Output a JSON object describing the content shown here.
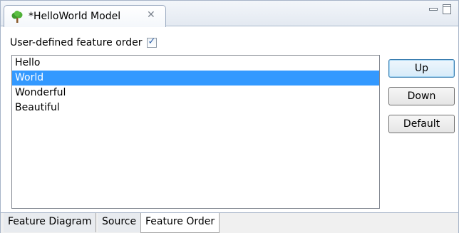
{
  "editor_tab": {
    "title": "*HelloWorld Model",
    "icon": "tree-icon",
    "close_icon": "close-icon"
  },
  "window_controls": [
    "minimize-icon",
    "maximize-icon"
  ],
  "feature_order": {
    "checkbox_label": "User-defined feature order",
    "checkbox_checked": true
  },
  "features": [
    {
      "label": "Hello",
      "selected": false
    },
    {
      "label": "World",
      "selected": true
    },
    {
      "label": "Wonderful",
      "selected": false
    },
    {
      "label": "Beautiful",
      "selected": false
    }
  ],
  "buttons": {
    "up": "Up",
    "down": "Down",
    "default": "Default"
  },
  "bottom_tabs": [
    {
      "label": "Feature Diagram",
      "active": false
    },
    {
      "label": "Source",
      "active": false
    },
    {
      "label": "Feature Order",
      "active": true
    }
  ],
  "colors": {
    "selection": "#3399ff",
    "tree_green": "#3f9a2c",
    "tree_trunk": "#8a5a2b"
  }
}
